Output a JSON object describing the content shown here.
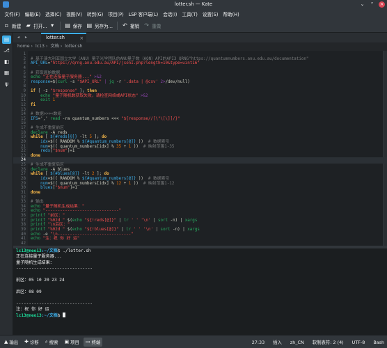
{
  "window": {
    "title": "lotter.sh — Kate"
  },
  "menu": [
    "文件(F)",
    "编辑(E)",
    "选择(C)",
    "视图(V)",
    "转到(G)",
    "项目(P)",
    "LSP 客户端(L)",
    "会话(I)",
    "工具(T)",
    "设置(S)",
    "帮助(H)"
  ],
  "toolbar": {
    "new": "新建",
    "open": "打开...",
    "save": "保存",
    "save_as": "另存为...",
    "undo": "撤销",
    "redo": "重做"
  },
  "tab": {
    "label": "lotter.sh"
  },
  "breadcrumb": [
    "home",
    "lc13",
    "文档",
    "lotter.sh"
  ],
  "editor": {
    "current_line": 24,
    "lines": [
      {
        "n": "1",
        "parts": []
      },
      {
        "n": "2",
        "parts": [
          {
            "c": "c-cmt",
            "t": "# 基于澳大利亚国立大学（ANU）量子光学团队的ANU量子数（AQN）API的API3 QRNG\"https://quantumnumbers.anu.edu.au/documentation\""
          }
        ]
      },
      {
        "n": "3",
        "parts": [
          {
            "c": "c-var",
            "t": "API_URL"
          },
          {
            "c": "c-txt",
            "t": "="
          },
          {
            "c": "c-str",
            "t": "\"https://qrng.anu.edu.au/API/jsonI.php?length=10&type=uint16\""
          }
        ]
      },
      {
        "n": "4",
        "parts": []
      },
      {
        "n": "5",
        "parts": [
          {
            "c": "c-cmt",
            "t": "# 获取原始数据"
          }
        ]
      },
      {
        "n": "6",
        "parts": [
          {
            "c": "c-cmd",
            "t": "echo "
          },
          {
            "c": "c-str",
            "t": "\"正在连接量子服务器...\""
          },
          {
            "c": "c-op",
            "t": " >&2"
          }
        ]
      },
      {
        "n": "7",
        "parts": [
          {
            "c": "c-var",
            "t": "response"
          },
          {
            "c": "c-txt",
            "t": "=$("
          },
          {
            "c": "c-cmd",
            "t": "curl"
          },
          {
            "c": "c-txt",
            "t": " -s "
          },
          {
            "c": "c-str",
            "t": "\"$API_URL\""
          },
          {
            "c": "c-op",
            "t": " | "
          },
          {
            "c": "c-cmd",
            "t": "jq"
          },
          {
            "c": "c-txt",
            "t": " -r "
          },
          {
            "c": "c-str",
            "t": "'.data | @csv'"
          },
          {
            "c": "c-op",
            "t": " 2>"
          },
          {
            "c": "c-txt",
            "t": "/dev/null)"
          }
        ]
      },
      {
        "n": "8",
        "parts": []
      },
      {
        "n": "9",
        "parts": [
          {
            "c": "c-key",
            "t": "if"
          },
          {
            "c": "c-txt",
            "t": " [ -z "
          },
          {
            "c": "c-str",
            "t": "\"$response\""
          },
          {
            "c": "c-txt",
            "t": " ]; "
          },
          {
            "c": "c-key",
            "t": "then"
          }
        ]
      },
      {
        "n": "10",
        "parts": [
          {
            "c": "c-cmd",
            "t": "    echo "
          },
          {
            "c": "c-str",
            "t": "\"量子随机数获取失败，请检查网络或API状态\""
          },
          {
            "c": "c-op",
            "t": " >&2"
          }
        ]
      },
      {
        "n": "11",
        "parts": [
          {
            "c": "c-cmd",
            "t": "    exit "
          },
          {
            "c": "c-num",
            "t": "1"
          }
        ]
      },
      {
        "n": "12",
        "parts": [
          {
            "c": "c-key",
            "t": "fi"
          }
        ]
      },
      {
        "n": "13",
        "parts": []
      },
      {
        "n": "14",
        "parts": [
          {
            "c": "c-cmt",
            "t": "# 数据>>><数组"
          }
        ]
      },
      {
        "n": "15",
        "parts": [
          {
            "c": "c-var",
            "t": "IFS"
          },
          {
            "c": "c-txt",
            "t": "=',' "
          },
          {
            "c": "c-cmd",
            "t": "read"
          },
          {
            "c": "c-txt",
            "t": " -ra quantum_numbers <<< "
          },
          {
            "c": "c-str",
            "t": "\"${response//[\\\"\\[\\]]/}\""
          }
        ]
      },
      {
        "n": "16",
        "parts": []
      },
      {
        "n": "17",
        "parts": [
          {
            "c": "c-cmt",
            "t": "# 生成不重复前区"
          }
        ]
      },
      {
        "n": "18",
        "parts": [
          {
            "c": "c-cmd",
            "t": "declare"
          },
          {
            "c": "c-txt",
            "t": " -A reds"
          }
        ]
      },
      {
        "n": "19",
        "parts": [
          {
            "c": "c-key",
            "t": "while"
          },
          {
            "c": "c-txt",
            "t": " [ "
          },
          {
            "c": "c-var",
            "t": "${#reds[@]}"
          },
          {
            "c": "c-txt",
            "t": " -lt "
          },
          {
            "c": "c-num",
            "t": "5"
          },
          {
            "c": "c-txt",
            "t": " ]; "
          },
          {
            "c": "c-key",
            "t": "do"
          }
        ]
      },
      {
        "n": "20",
        "parts": [
          {
            "c": "c-var",
            "t": "    idx"
          },
          {
            "c": "c-txt",
            "t": "=$(( RANDOM % "
          },
          {
            "c": "c-var",
            "t": "${#quantum_numbers[@]}"
          },
          {
            "c": "c-txt",
            "t": " ))  "
          },
          {
            "c": "c-cmt",
            "t": "# 数据索引"
          }
        ]
      },
      {
        "n": "21",
        "parts": [
          {
            "c": "c-var",
            "t": "    num"
          },
          {
            "c": "c-txt",
            "t": "=$(( quantum_numbers[idx] % "
          },
          {
            "c": "c-num",
            "t": "35"
          },
          {
            "c": "c-txt",
            "t": " + "
          },
          {
            "c": "c-num",
            "t": "1"
          },
          {
            "c": "c-txt",
            "t": " ))  "
          },
          {
            "c": "c-cmt",
            "t": "# 映射范围1-35"
          }
        ]
      },
      {
        "n": "22",
        "parts": [
          {
            "c": "c-var",
            "t": "    reds"
          },
          {
            "c": "c-txt",
            "t": "["
          },
          {
            "c": "c-str",
            "t": "\"$num\""
          },
          {
            "c": "c-txt",
            "t": "]=1"
          }
        ]
      },
      {
        "n": "23",
        "parts": [
          {
            "c": "c-key",
            "t": "done"
          }
        ]
      },
      {
        "n": "24",
        "parts": []
      },
      {
        "n": "25",
        "parts": [
          {
            "c": "c-cmt",
            "t": "# 生成不重复后区"
          }
        ]
      },
      {
        "n": "26",
        "parts": [
          {
            "c": "c-cmd",
            "t": "declare"
          },
          {
            "c": "c-txt",
            "t": " -A blues"
          }
        ]
      },
      {
        "n": "27",
        "parts": [
          {
            "c": "c-key",
            "t": "while"
          },
          {
            "c": "c-txt",
            "t": " [ "
          },
          {
            "c": "c-var",
            "t": "${#blues[@]}"
          },
          {
            "c": "c-txt",
            "t": " -lt "
          },
          {
            "c": "c-num",
            "t": "2"
          },
          {
            "c": "c-txt",
            "t": " ]; "
          },
          {
            "c": "c-key",
            "t": "do"
          }
        ]
      },
      {
        "n": "28",
        "parts": [
          {
            "c": "c-var",
            "t": "    idx"
          },
          {
            "c": "c-txt",
            "t": "=$(( RANDOM % "
          },
          {
            "c": "c-var",
            "t": "${#quantum_numbers[@]}"
          },
          {
            "c": "c-txt",
            "t": " ))  "
          },
          {
            "c": "c-cmt",
            "t": "# 数据索引"
          }
        ]
      },
      {
        "n": "29",
        "parts": [
          {
            "c": "c-var",
            "t": "    num"
          },
          {
            "c": "c-txt",
            "t": "=$(( quantum_numbers[idx] % "
          },
          {
            "c": "c-num",
            "t": "12"
          },
          {
            "c": "c-txt",
            "t": " + "
          },
          {
            "c": "c-num",
            "t": "1"
          },
          {
            "c": "c-txt",
            "t": " ))  "
          },
          {
            "c": "c-cmt",
            "t": "# 映射范围1-12"
          }
        ]
      },
      {
        "n": "30",
        "parts": [
          {
            "c": "c-var",
            "t": "    blues"
          },
          {
            "c": "c-txt",
            "t": "["
          },
          {
            "c": "c-str",
            "t": "\"$num\""
          },
          {
            "c": "c-txt",
            "t": "]=1"
          }
        ]
      },
      {
        "n": "31",
        "parts": [
          {
            "c": "c-key",
            "t": "done"
          }
        ]
      },
      {
        "n": "32",
        "parts": []
      },
      {
        "n": "33",
        "parts": [
          {
            "c": "c-cmt",
            "t": "# 输出"
          }
        ]
      },
      {
        "n": "34",
        "parts": [
          {
            "c": "c-cmd",
            "t": "echo "
          },
          {
            "c": "c-str",
            "t": "\"量子随机生成结果：\""
          }
        ]
      },
      {
        "n": "35",
        "parts": [
          {
            "c": "c-cmd",
            "t": "echo "
          },
          {
            "c": "c-str",
            "t": "\"------------------------------\""
          }
        ]
      },
      {
        "n": "36",
        "parts": [
          {
            "c": "c-cmd",
            "t": "printf "
          },
          {
            "c": "c-str",
            "t": "\"前区：\""
          }
        ]
      },
      {
        "n": "37",
        "parts": [
          {
            "c": "c-cmd",
            "t": "printf "
          },
          {
            "c": "c-str",
            "t": "\"%02d \""
          },
          {
            "c": "c-txt",
            "t": " $("
          },
          {
            "c": "c-cmd",
            "t": "echo "
          },
          {
            "c": "c-str",
            "t": "\"${!reds[@]}\""
          },
          {
            "c": "c-txt",
            "t": " | "
          },
          {
            "c": "c-cmd",
            "t": "tr"
          },
          {
            "c": "c-str",
            "t": " ' ' '\\n'"
          },
          {
            "c": "c-txt",
            "t": " | "
          },
          {
            "c": "c-cmd",
            "t": "sort"
          },
          {
            "c": "c-txt",
            "t": " -n) | "
          },
          {
            "c": "c-cmd",
            "t": "xargs"
          }
        ]
      },
      {
        "n": "38",
        "parts": [
          {
            "c": "c-cmd",
            "t": "printf "
          },
          {
            "c": "c-str",
            "t": "\"\\n后区：\""
          }
        ]
      },
      {
        "n": "39",
        "parts": [
          {
            "c": "c-cmd",
            "t": "printf "
          },
          {
            "c": "c-str",
            "t": "\"%02d \""
          },
          {
            "c": "c-txt",
            "t": " $("
          },
          {
            "c": "c-cmd",
            "t": "echo "
          },
          {
            "c": "c-str",
            "t": "\"${!blues[@]}\""
          },
          {
            "c": "c-txt",
            "t": " | "
          },
          {
            "c": "c-cmd",
            "t": "tr"
          },
          {
            "c": "c-str",
            "t": " ' ' '\\n'"
          },
          {
            "c": "c-txt",
            "t": " | "
          },
          {
            "c": "c-cmd",
            "t": "sort"
          },
          {
            "c": "c-txt",
            "t": " -n) | "
          },
          {
            "c": "c-cmd",
            "t": "xargs"
          }
        ]
      },
      {
        "n": "40",
        "parts": [
          {
            "c": "c-cmd",
            "t": "echo "
          },
          {
            "c": "c-txt",
            "t": "-e "
          },
          {
            "c": "c-str",
            "t": "\"\\n------------------------------\""
          }
        ]
      },
      {
        "n": "41",
        "parts": [
          {
            "c": "c-cmd",
            "t": "echo "
          },
          {
            "c": "c-str",
            "t": "\"注：祝 你 好 运\""
          }
        ]
      },
      {
        "n": "42",
        "parts": []
      }
    ]
  },
  "terminal": {
    "user": "lc13@neoi3",
    "path": ":~/文档",
    "command": "$ ./lotter.sh",
    "output": [
      "正在连接量子服务器...",
      "量子随机生成结果：",
      "------------------------------",
      "",
      "前区：05 10 20 23 24",
      "",
      "后区：08 09",
      "",
      "------------------------------",
      "注：祝 你 好 运"
    ],
    "prompt_end": "$ "
  },
  "status": {
    "tabs": [
      {
        "icon": "bug-icon",
        "glyph": "▲",
        "label": "输出"
      },
      {
        "icon": "diagnostics-icon",
        "glyph": "✚",
        "label": "诊断"
      },
      {
        "icon": "search-icon",
        "glyph": "⌕",
        "label": "搜索"
      },
      {
        "icon": "project-icon",
        "glyph": "▣",
        "label": "项目"
      },
      {
        "icon": "terminal-icon",
        "glyph": "▭",
        "label": "终端"
      }
    ],
    "position": "27:33",
    "mode": "插入",
    "language": "zh_CN",
    "indent": "软制表符: 2 (4)",
    "encoding": "UTF-8",
    "syntax": "Bash"
  }
}
